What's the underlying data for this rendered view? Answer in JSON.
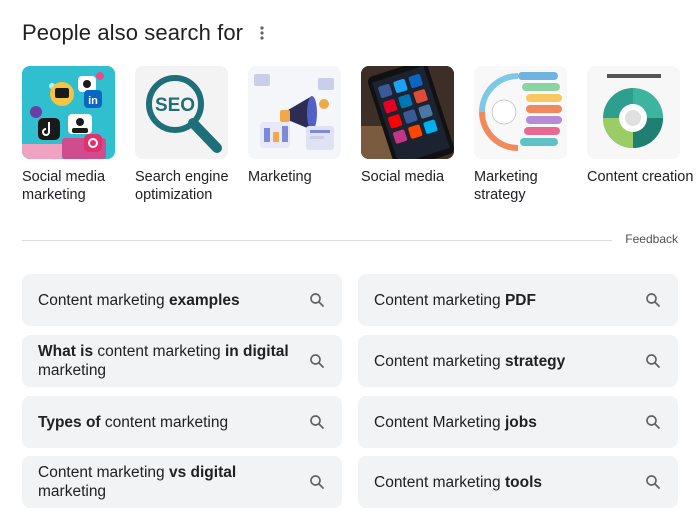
{
  "section": {
    "title": "People also search for",
    "feedback": "Feedback"
  },
  "cards": [
    {
      "label": "Social media marketing",
      "icon": "social-media-marketing-image"
    },
    {
      "label": "Search engine optimization",
      "icon": "seo-magnifier-image"
    },
    {
      "label": "Marketing",
      "icon": "marketing-megaphone-image"
    },
    {
      "label": "Social media",
      "icon": "social-media-phone-image"
    },
    {
      "label": "Marketing strategy",
      "icon": "marketing-strategy-infographic"
    },
    {
      "label": "Content creation",
      "icon": "content-recycle-diagram"
    }
  ],
  "seo_text": "SEO",
  "related": [
    {
      "pre": "Content marketing ",
      "bold": "examples",
      "post": ""
    },
    {
      "pre": "Content marketing ",
      "bold": "PDF",
      "post": ""
    },
    {
      "pre": "",
      "bold": "What is",
      "post": " content marketing ",
      "bold2": "in digital",
      "post2": " marketing"
    },
    {
      "pre": "Content marketing ",
      "bold": "strategy",
      "post": ""
    },
    {
      "pre": "",
      "bold": "Types of",
      "post": " content marketing"
    },
    {
      "pre": "Content Marketing ",
      "bold": "jobs",
      "post": ""
    },
    {
      "pre": "Content marketing ",
      "bold": "vs digital",
      "post": " marketing"
    },
    {
      "pre": "Content marketing ",
      "bold": "tools",
      "post": ""
    }
  ],
  "colors": {
    "chip_bg": "#f1f3f4",
    "divider": "#dadce0",
    "text": "#202124",
    "icon": "#5f6368"
  }
}
